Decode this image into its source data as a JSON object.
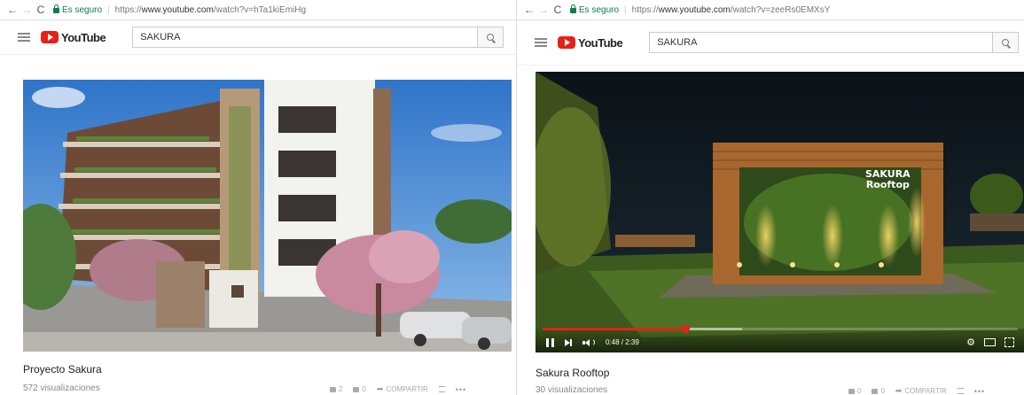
{
  "left": {
    "browser": {
      "back": "←",
      "forward": "→",
      "reload": "C",
      "secure_label": "Es seguro",
      "url_scheme": "https://",
      "url_host": "www.youtube.com",
      "url_path": "/watch?v=hTa1kiEmiHg"
    },
    "youtube": {
      "logo_text": "YouTube",
      "search_value": "SAKURA"
    },
    "video": {
      "title": "Proyecto Sakura",
      "views": "572 visualizaciones"
    },
    "actions": {
      "likes": "2",
      "dislikes": "0",
      "share": "COMPARTIR",
      "more": "•••"
    }
  },
  "right": {
    "browser": {
      "back": "←",
      "forward": "→",
      "reload": "C",
      "secure_label": "Es seguro",
      "url_scheme": "https://",
      "url_host": "www.youtube.com",
      "url_path": "/watch?v=zeeRs0EMXsY"
    },
    "youtube": {
      "logo_text": "YouTube",
      "search_value": "SAKURA"
    },
    "video": {
      "title": "Sakura Rooftop",
      "views": "30 visualizaciones",
      "overlay_line1": "SAKURA",
      "overlay_line2": "Rooftop",
      "time": "0:48 / 2:39",
      "progress_fraction": 0.3,
      "buffered_fraction": 0.42
    },
    "actions": {
      "likes": "0",
      "dislikes": "0",
      "share": "COMPARTIR",
      "more": "•••"
    }
  },
  "colors": {
    "youtube_red": "#e62117",
    "secure_green": "#0b8043"
  },
  "icons": [
    "back-arrow-icon",
    "forward-arrow-icon",
    "reload-icon",
    "lock-icon",
    "menu-icon",
    "youtube-logo-icon",
    "search-icon",
    "like-icon",
    "dislike-icon",
    "share-icon",
    "add-to-playlist-icon",
    "more-icon",
    "pause-icon",
    "next-icon",
    "volume-icon",
    "settings-gear-icon",
    "theater-mode-icon",
    "fullscreen-icon"
  ]
}
